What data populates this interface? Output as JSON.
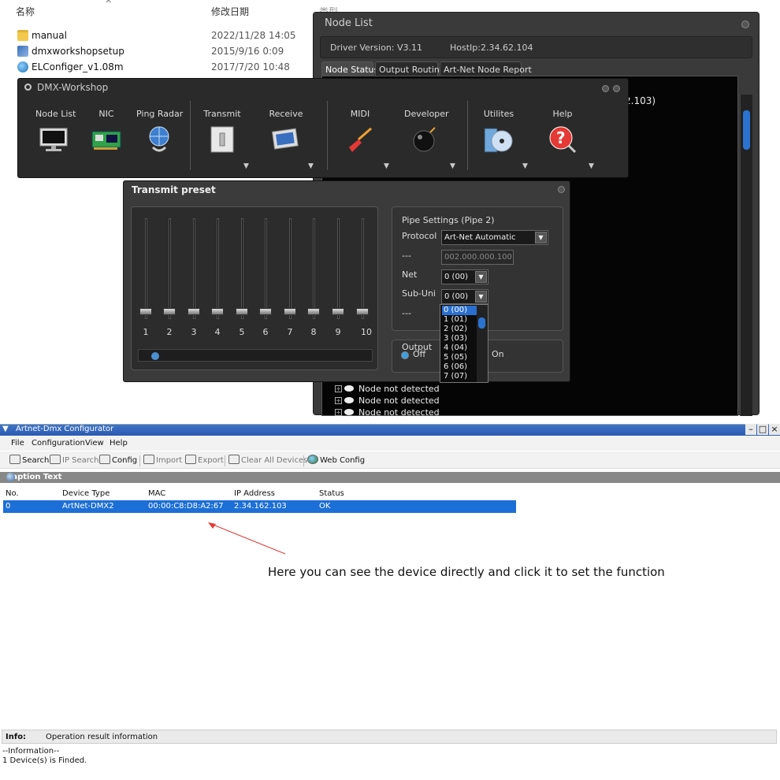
{
  "explorer": {
    "col_name": "名称",
    "col_date": "修改日期",
    "col_type": "类型",
    "files": [
      {
        "name": "manual",
        "date": "2022/11/28 14:05",
        "icon": "folder-icon"
      },
      {
        "name": "dmxworkshopsetup",
        "date": "2015/9/16 0:09",
        "icon": "installer-icon"
      },
      {
        "name": "ELConfiger_v1.08m",
        "date": "2017/7/20 10:48",
        "icon": "app-globe-icon"
      }
    ]
  },
  "node_list": {
    "title": "Node List",
    "driver_version": "Driver Version: V3.11",
    "host_ip": "HostIp:2.34.62.104",
    "tabs": [
      "Node Status",
      "Output Routing",
      "Art-Net Node Report"
    ],
    "ip_fragment": "2.103)",
    "nodes": [
      "Node not detected",
      "Node not detected",
      "Node not detected"
    ]
  },
  "dmx_workshop": {
    "title": "DMX-Workshop",
    "tools": [
      {
        "label": "Node List",
        "icon": "monitor-icon"
      },
      {
        "label": "NIC",
        "icon": "network-card-icon"
      },
      {
        "label": "Ping Radar",
        "icon": "globe-radar-icon"
      },
      {
        "label": "Transmit",
        "icon": "transmit-switch-icon"
      },
      {
        "label": "Receive",
        "icon": "receive-screen-icon"
      },
      {
        "label": "MIDI",
        "icon": "guitar-icon"
      },
      {
        "label": "Developer",
        "icon": "bomb-icon"
      },
      {
        "label": "Utilites",
        "icon": "disc-icon"
      },
      {
        "label": "Help",
        "icon": "help-icon"
      }
    ]
  },
  "transmit_preset": {
    "title": "Transmit preset",
    "fader_labels": [
      "1",
      "2",
      "3",
      "4",
      "5",
      "6",
      "7",
      "8",
      "9",
      "10"
    ],
    "pipe_settings_title": "Pipe Settings (Pipe 2)",
    "protocol_label": "Protocol",
    "protocol_value": "Art-Net Automatic",
    "address_label": "---",
    "address_value": "002.000.000.100",
    "net_label": "Net",
    "net_value": "0 (00)",
    "subuni_label": "Sub-Uni",
    "subuni_value": "0 (00)",
    "extra_label": "---",
    "output_label": "Output",
    "off_label": "Off",
    "on_label": "On",
    "subuni_options": [
      "0 (00)",
      "1 (01)",
      "2 (02)",
      "3 (03)",
      "4 (04)",
      "5 (05)",
      "6 (06)",
      "7 (07)"
    ]
  },
  "configurator": {
    "title": "Artnet-Dmx Configurator",
    "menu": [
      "File",
      "Configuration",
      "View",
      "Help"
    ],
    "toolbar": {
      "search": "Search",
      "ip_search": "IP Search",
      "config": "Config",
      "import": "Import",
      "export": "Export",
      "clear_all": "Clear All Devices",
      "web_config": "Web Config"
    },
    "caption": "Caption Text",
    "columns": [
      "No.",
      "Device Type",
      "MAC",
      "IP Address",
      "Status"
    ],
    "rows": [
      {
        "no": "0",
        "device_type": "ArtNet-DMX2",
        "mac": "00:00:C8:D8:A2:67",
        "ip": "2.34.162.103",
        "status": "OK"
      }
    ],
    "annotation": "Here you can see the device directly and click it to set the function",
    "info_label": "Info:",
    "info_value": "Operation result information",
    "log_line1": "--Information--",
    "log_line2": "1 Device(s) is Finded."
  },
  "colors": {
    "selection": "#1c6fd6",
    "annotation_arrow": "#e53935",
    "dark_ui": "#3a3a3a"
  }
}
